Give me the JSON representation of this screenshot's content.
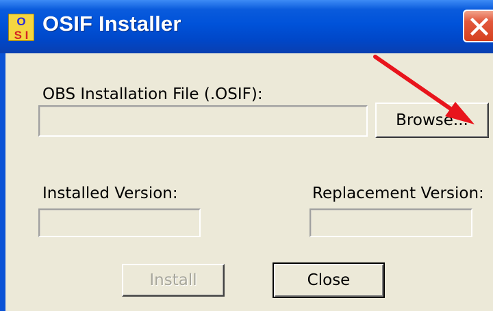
{
  "window": {
    "title": "OSIF Installer"
  },
  "icon": {
    "name": "osif-app-icon",
    "letters_top": "O",
    "letters_bottom": "S I"
  },
  "form": {
    "file_label": "OBS Installation File (.OSIF):",
    "file_value": "",
    "browse_label": "Browse...",
    "installed_label": "Installed Version:",
    "installed_value": "",
    "replacement_label": "Replacement Version:",
    "replacement_value": ""
  },
  "buttons": {
    "install_label": "Install",
    "close_label": "Close"
  },
  "annotation": {
    "type": "red-arrow",
    "color": "#e8141c"
  }
}
